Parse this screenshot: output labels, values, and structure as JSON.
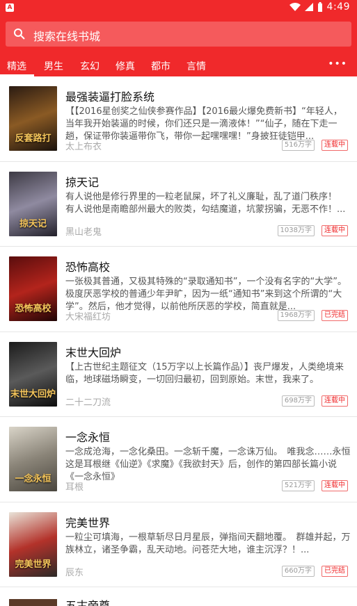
{
  "status": {
    "time": "4:49",
    "app_badge": "A"
  },
  "search": {
    "placeholder": "搜索在线书城"
  },
  "tabs": [
    {
      "label": "精选"
    },
    {
      "label": "男生"
    },
    {
      "label": "玄幻"
    },
    {
      "label": "修真"
    },
    {
      "label": "都市"
    },
    {
      "label": "言情"
    }
  ],
  "more_label": "•••",
  "books": [
    {
      "title": "最强装逼打脸系统",
      "desc": "【【2016星创奖之仙侠参赛作品】【2016最火爆免费新书】“年轻人，当年我开始装逼的时候，你们还只是一滴液体！”“仙子，随在下走一趟，保证带你装逼带你飞，带你一起嘿嘿嘿！”身披狂徒铠甲...",
      "author": "太上布衣",
      "words": "516万字",
      "status": "连载中",
      "cover_text": "反套路打",
      "cover_colors": [
        "#2b1b12",
        "#8a5a24",
        "#1a120c"
      ]
    },
    {
      "title": "掠天记",
      "desc": "有人说他是修行界里的一粒老鼠屎，坏了礼义廉耻，乱了道门秩序！　有人说他是南瞻部州最大的败类，勾结魔道，坑蒙拐骗，无恶不作！...",
      "author": "黑山老鬼",
      "words": "1038万字",
      "status": "连载中",
      "cover_text": "掠天记",
      "cover_colors": [
        "#3d3a44",
        "#8f8aa0",
        "#22202a"
      ]
    },
    {
      "title": "恐怖高校",
      "desc": "一张极其普通，又极其特殊的“录取通知书”，一个没有名字的“大学”。极度厌恶学校的普通少年尹旷，因为一纸“通知书”来到这个所谓的“大学”。然后，他才觉得，以前他所厌恶的学校，简直就是...",
      "author": "大宋福红坊",
      "words": "1968万字",
      "status": "已完结",
      "cover_text": "恐怖高校",
      "cover_colors": [
        "#5a0d0d",
        "#b3241c",
        "#200505"
      ]
    },
    {
      "title": "末世大回炉",
      "desc": "【上古世纪主题征文（15万字以上长篇作品）】丧尸爆发，人类绝境来临，地球磁场瞬变，一切回归最初，回到原始。末世，我来了。",
      "author": "二十二刀流",
      "words": "698万字",
      "status": "连载中",
      "cover_text": "末世大回炉",
      "cover_colors": [
        "#1b1b1b",
        "#5a5a5a",
        "#0d0d0d"
      ]
    },
    {
      "title": "一念永恒",
      "desc": "一念成沧海，一念化桑田。一念斩千魔，一念诛万仙。　唯我念……永恒　这是耳根继《仙逆》《求魔》《我欲封天》后，创作的第四部长篇小说《一念永恒》",
      "author": "耳根",
      "words": "521万字",
      "status": "连载中",
      "cover_text": "一念永恒",
      "cover_colors": [
        "#d9d4c8",
        "#8a8478",
        "#4a463e"
      ]
    },
    {
      "title": "完美世界",
      "desc": "一粒尘可填海，一根草斩尽日月星辰，弹指间天翻地覆。　群雄并起，万族林立，诸圣争霸，乱天动地。问苍茫大地，谁主沉浮？！...",
      "author": "辰东",
      "words": "660万字",
      "status": "已完结",
      "cover_text": "完美世界",
      "cover_colors": [
        "#e9e3d8",
        "#b3322a",
        "#2c2a28"
      ]
    }
  ],
  "partial_title": "五古帝尊"
}
